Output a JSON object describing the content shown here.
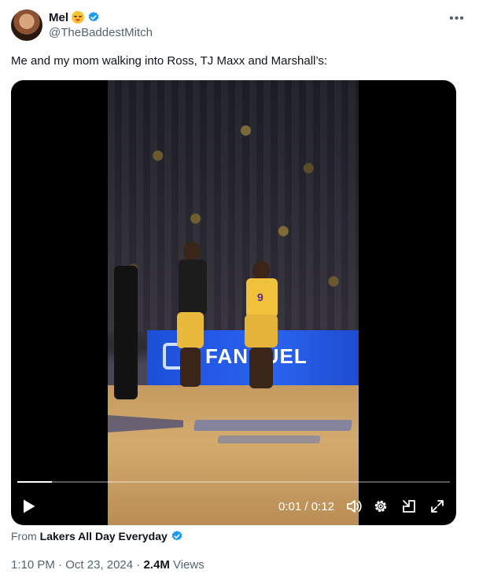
{
  "author": {
    "display_name": "Mel",
    "handle": "@TheBaddestMitch"
  },
  "tweet": {
    "text": "Me and my mom walking into Ross, TJ Maxx and Marshall’s:"
  },
  "video": {
    "current_time": "0:01",
    "separator": " / ",
    "duration": "0:12",
    "progress_fraction": 0.08,
    "scene_text": "FANDUEL",
    "jersey_number": "9"
  },
  "source": {
    "prefix": "From",
    "name": "Lakers All Day Everyday"
  },
  "meta": {
    "time": "1:10 PM",
    "dot1": " · ",
    "date": "Oct 23, 2024",
    "dot2": " · ",
    "views_count": "2.4M",
    "views_label": " Views"
  },
  "colors": {
    "verified": "#1d9bf0",
    "muted": "#536471",
    "text": "#0f1419"
  },
  "icons": [
    "more-icon",
    "verified-badge-icon",
    "emoji-icon",
    "play-icon",
    "volume-icon",
    "gear-icon",
    "pip-icon",
    "fullscreen-icon"
  ]
}
